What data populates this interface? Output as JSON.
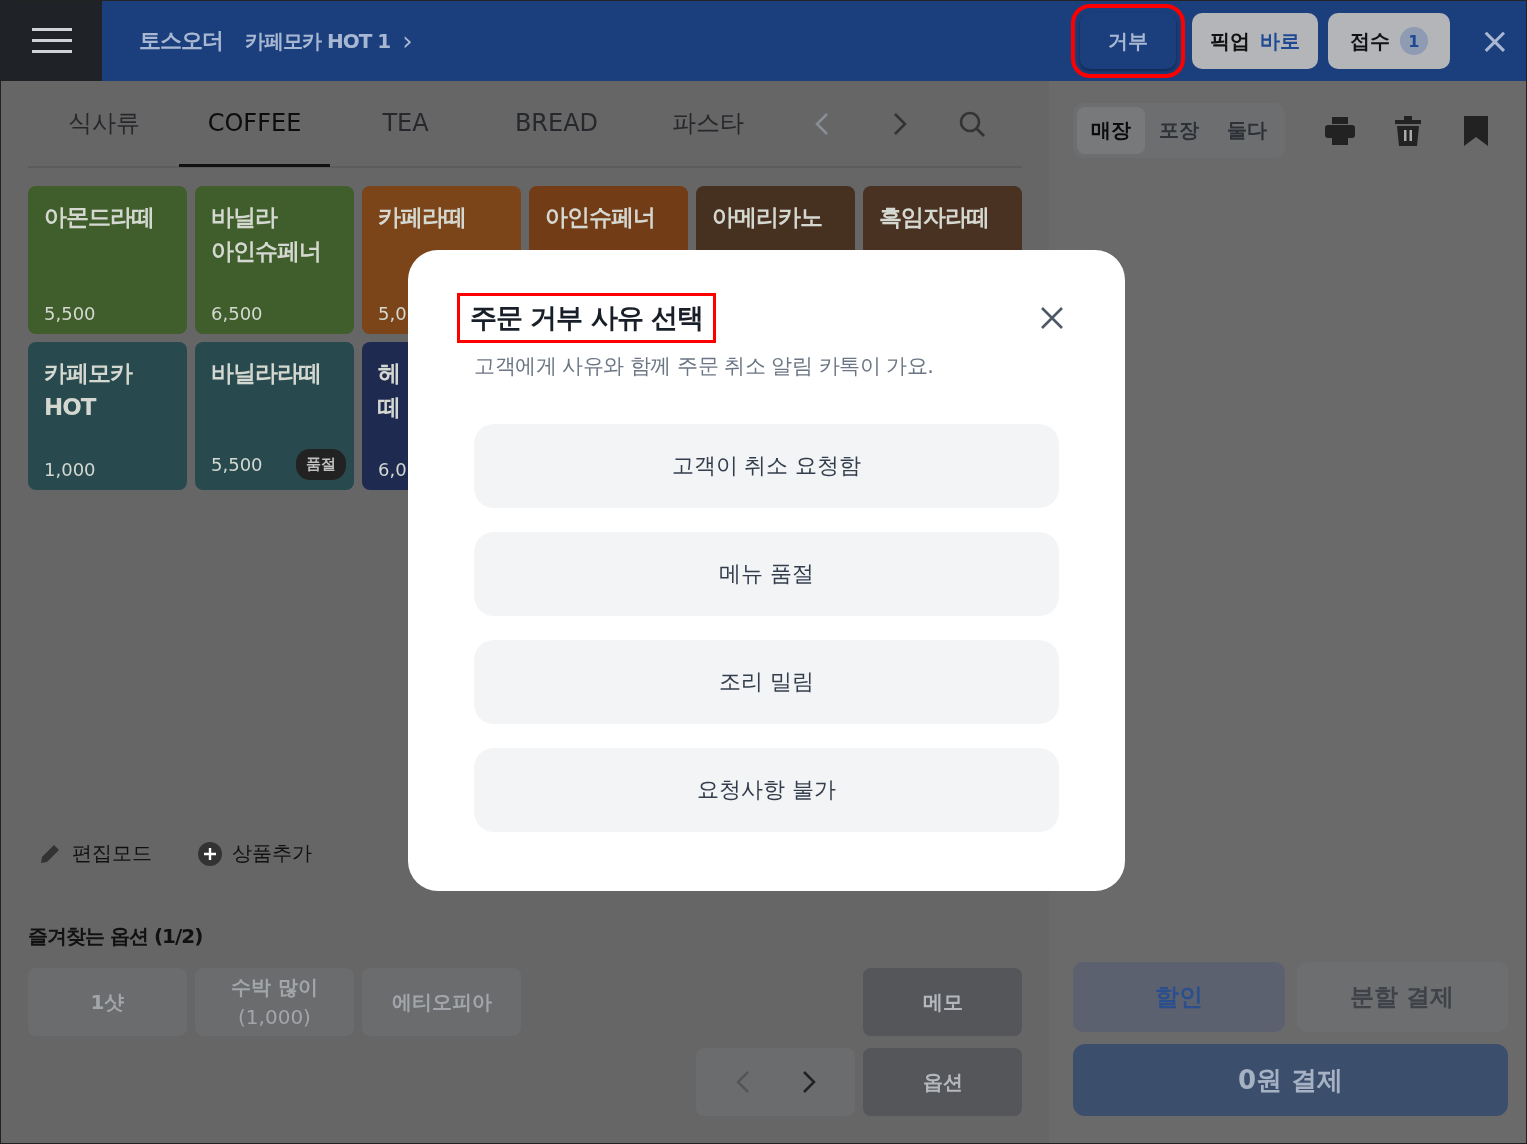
{
  "header": {
    "store": "토스오더",
    "order": "카페모카 HOT 1",
    "order_arrow": "›",
    "buttons": [
      {
        "kind": "reject",
        "label": "거부",
        "highlighted": true
      },
      {
        "kind": "pickup",
        "label": "픽업",
        "accent": "바로",
        "highlighted": false
      },
      {
        "kind": "accept",
        "label": "접수",
        "badge": "1",
        "highlighted": false
      }
    ],
    "close": "×"
  },
  "tabs": [
    {
      "label": "식사류",
      "selected": false
    },
    {
      "label": "COFFEE",
      "selected": true
    },
    {
      "label": "TEA",
      "selected": false
    },
    {
      "label": "BREAD",
      "selected": false
    },
    {
      "label": "파스타",
      "selected": false
    }
  ],
  "menu": [
    {
      "lines": [
        "아몬드라떼"
      ],
      "price": "5,500",
      "color": "#3f5e2c"
    },
    {
      "lines": [
        "바닐라",
        "아인슈페너"
      ],
      "price": "6,500",
      "color": "#3f5e2c"
    },
    {
      "lines": [
        "카페라떼"
      ],
      "price": "5,0",
      "color": "#7c4419"
    },
    {
      "lines": [
        "아인슈페너"
      ],
      "color": "#723c17"
    },
    {
      "lines": [
        "아메리카노"
      ],
      "color": "#46301f"
    },
    {
      "lines": [
        "흑임자라떼"
      ],
      "color": "#4a3222"
    },
    {
      "lines": [
        "카페모카",
        "HOT"
      ],
      "price": "1,000",
      "color": "#284a4e"
    },
    {
      "lines": [
        "바닐라라떼"
      ],
      "price": "5,500",
      "color": "#284a4e",
      "sold_out": "품절"
    },
    {
      "lines": [
        "헤",
        "떼"
      ],
      "price": "6,0",
      "color": "#1e2a50"
    }
  ],
  "tools": [
    {
      "kind": "edit",
      "label": "편집모드"
    },
    {
      "kind": "add",
      "label": "상품추가"
    }
  ],
  "favorites": {
    "title": "즐겨찾는 옵션 (1/2)",
    "options": [
      {
        "label": "1샷"
      },
      {
        "label": "수박 많이",
        "sub": "(1,000)"
      },
      {
        "label": "에티오피아"
      }
    ],
    "memo": "메모",
    "option": "옵션"
  },
  "order_panel": {
    "segments": [
      {
        "label": "매장",
        "selected": true
      },
      {
        "label": "포장",
        "selected": false
      },
      {
        "label": "둘다",
        "selected": false
      }
    ],
    "discount": "할인",
    "split": "분할 결제",
    "pay": "0원 결제"
  },
  "dialog": {
    "title": "주문 거부 사유 선택",
    "title_highlighted": true,
    "subtitle": "고객에게 사유와 함께 주문 취소 알림 카톡이 가요.",
    "reasons": [
      "고객이 취소 요청함",
      "메뉴 품절",
      "조리 밀림",
      "요청사항 불가"
    ]
  }
}
